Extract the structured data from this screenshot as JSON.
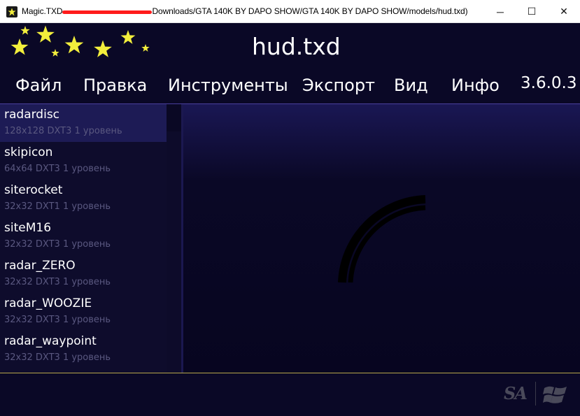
{
  "window": {
    "title_prefix": "Magic.TXD",
    "title_suffix": "Downloads/GTA 140K BY DAPO SHOW/GTA 140K BY DAPO SHOW/models/hud.txd)",
    "minimize_glyph": "─",
    "maximize_glyph": "☐",
    "close_glyph": "✕"
  },
  "header": {
    "file_name": "hud.txd"
  },
  "menu": {
    "items": [
      {
        "label": "Файл"
      },
      {
        "label": "Правка"
      },
      {
        "label": "Инструменты"
      },
      {
        "label": "Экспорт"
      },
      {
        "label": "Вид"
      },
      {
        "label": "Инфо"
      }
    ],
    "version": "3.6.0.3"
  },
  "textures": [
    {
      "name": "radardisc",
      "info": "128x128 DXT3 1 уровень",
      "selected": true
    },
    {
      "name": "skipicon",
      "info": "64x64 DXT3 1 уровень",
      "selected": false
    },
    {
      "name": "siterocket",
      "info": "32x32 DXT1 1 уровень",
      "selected": false
    },
    {
      "name": "siteM16",
      "info": "32x32 DXT3 1 уровень",
      "selected": false
    },
    {
      "name": "radar_ZERO",
      "info": "32x32 DXT3 1 уровень",
      "selected": false
    },
    {
      "name": "radar_WOOZIE",
      "info": "32x32 DXT3 1 уровень",
      "selected": false
    },
    {
      "name": "radar_waypoint",
      "info": "32x32 DXT3 1 уровень",
      "selected": false
    }
  ],
  "footer": {
    "game_logo": "SA",
    "platform_icon": "windows-logo-icon"
  },
  "colors": {
    "background": "#0a0826",
    "selected_item": "#1d1b55",
    "star": "#f2ee3c",
    "footer_border": "#b8a84a"
  }
}
